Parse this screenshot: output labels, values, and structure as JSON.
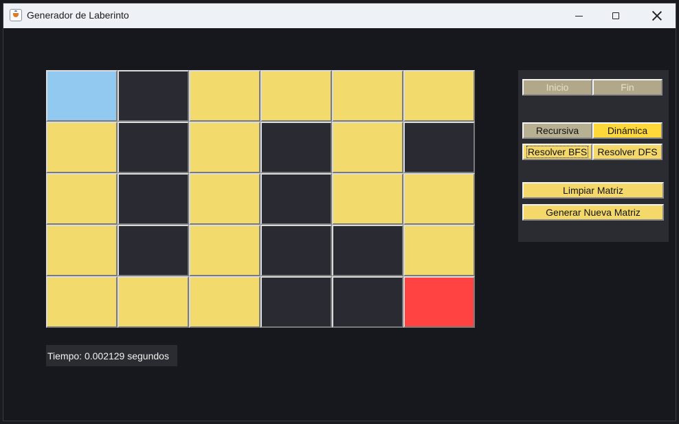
{
  "window": {
    "title": "Generador de Laberinto",
    "controls": {
      "minimize": "minimize-icon",
      "maximize": "maximize-icon",
      "close": "close-icon"
    }
  },
  "maze": {
    "rows": 5,
    "cols": 6,
    "legend": {
      "S": "start",
      "E": "end",
      "W": "wall",
      "P": "path"
    },
    "grid": [
      [
        "S",
        "W",
        "P",
        "P",
        "P",
        "P"
      ],
      [
        "P",
        "W",
        "P",
        "W",
        "P",
        "W"
      ],
      [
        "P",
        "W",
        "P",
        "W",
        "P",
        "P"
      ],
      [
        "P",
        "W",
        "P",
        "W",
        "W",
        "P"
      ],
      [
        "P",
        "P",
        "P",
        "W",
        "W",
        "E"
      ]
    ],
    "colors": {
      "start": "#92c9f0",
      "end": "#ff4242",
      "wall": "#2a2b32",
      "path": "#f3da6c"
    }
  },
  "status": {
    "text": "Tiempo: 0.002129 segundos"
  },
  "panel": {
    "inicio_label": "Inicio",
    "fin_label": "Fin",
    "recursiva_label": "Recursiva",
    "dinamica_label": "Dinámica",
    "bfs_label": "Resolver BFS",
    "dfs_label": "Resolver DFS",
    "limpiar_label": "Limpiar Matriz",
    "generar_label": "Generar Nueva Matriz"
  }
}
